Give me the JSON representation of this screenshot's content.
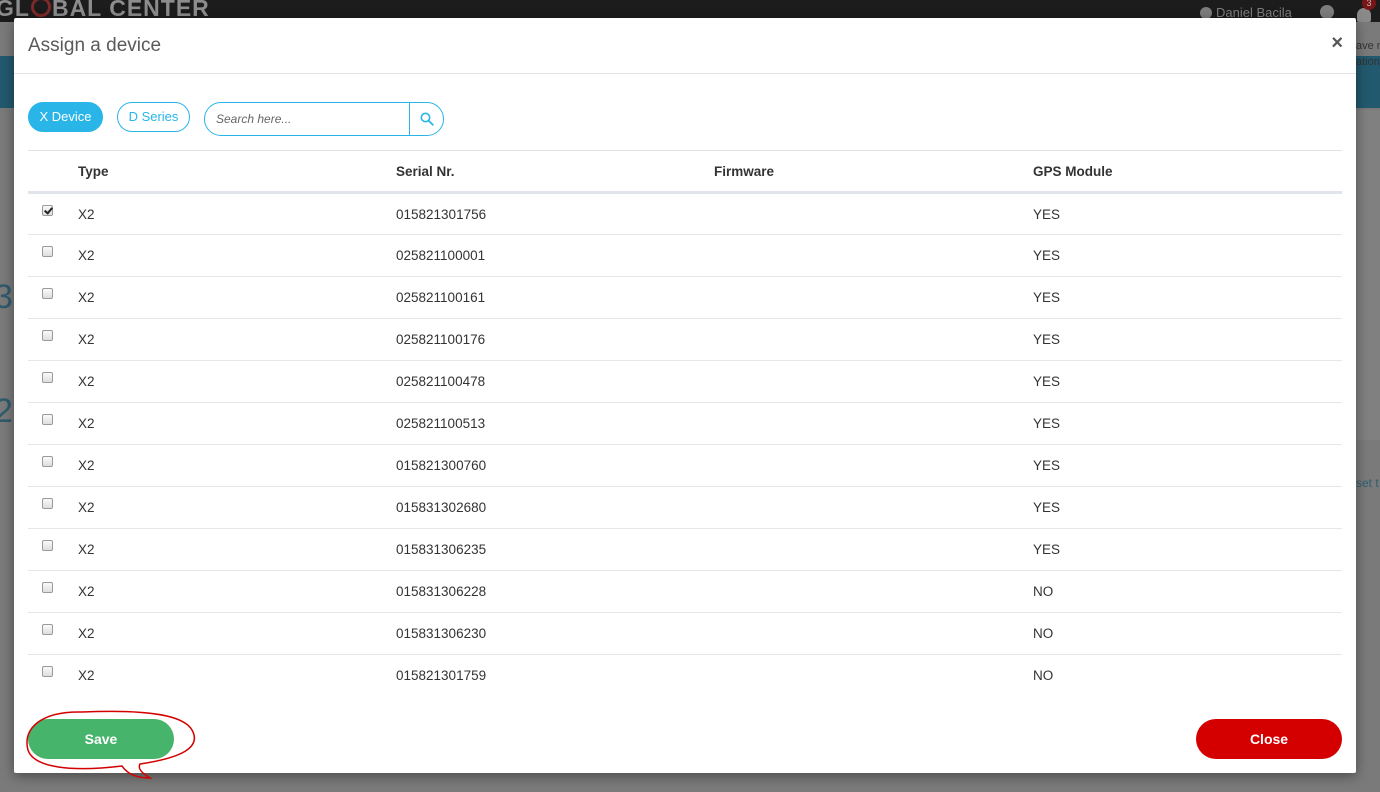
{
  "background": {
    "logo_left": "GL",
    "logo_mid": "BAL",
    "logo_right": "CENTER",
    "user_name": "Daniel Bacila",
    "notification_count": "3",
    "notification_text_line1": "ave n",
    "notification_text_line2": "ation",
    "big_number_1": "3",
    "big_number_2": "2",
    "link_fragment": "set t"
  },
  "modal": {
    "title": "Assign a device",
    "close_symbol": "×",
    "filters": {
      "active": "X Device",
      "inactive": "D Series"
    },
    "search": {
      "placeholder": "Search here...",
      "value": ""
    },
    "table": {
      "headers": {
        "type": "Type",
        "serial": "Serial Nr.",
        "firmware": "Firmware",
        "gps": "GPS Module"
      },
      "rows": [
        {
          "checked": true,
          "type": "X2",
          "serial": "015821301756",
          "firmware": "",
          "gps": "YES"
        },
        {
          "checked": false,
          "type": "X2",
          "serial": "025821100001",
          "firmware": "",
          "gps": "YES"
        },
        {
          "checked": false,
          "type": "X2",
          "serial": "025821100161",
          "firmware": "",
          "gps": "YES"
        },
        {
          "checked": false,
          "type": "X2",
          "serial": "025821100176",
          "firmware": "",
          "gps": "YES"
        },
        {
          "checked": false,
          "type": "X2",
          "serial": "025821100478",
          "firmware": "",
          "gps": "YES"
        },
        {
          "checked": false,
          "type": "X2",
          "serial": "025821100513",
          "firmware": "",
          "gps": "YES"
        },
        {
          "checked": false,
          "type": "X2",
          "serial": "015821300760",
          "firmware": "",
          "gps": "YES"
        },
        {
          "checked": false,
          "type": "X2",
          "serial": "015831302680",
          "firmware": "",
          "gps": "YES"
        },
        {
          "checked": false,
          "type": "X2",
          "serial": "015831306235",
          "firmware": "",
          "gps": "YES"
        },
        {
          "checked": false,
          "type": "X2",
          "serial": "015831306228",
          "firmware": "",
          "gps": "NO"
        },
        {
          "checked": false,
          "type": "X2",
          "serial": "015831306230",
          "firmware": "",
          "gps": "NO"
        },
        {
          "checked": false,
          "type": "X2",
          "serial": "015821301759",
          "firmware": "",
          "gps": "NO"
        }
      ]
    },
    "save_label": "Save",
    "close_label": "Close"
  },
  "colors": {
    "accent": "#29b5e8",
    "save": "#46b46a",
    "close": "#d40000",
    "annotation": "#d40000"
  },
  "icons": {
    "search": "search-icon",
    "close": "close-icon",
    "user": "user-icon",
    "help": "help-icon",
    "bell": "bell-icon"
  }
}
